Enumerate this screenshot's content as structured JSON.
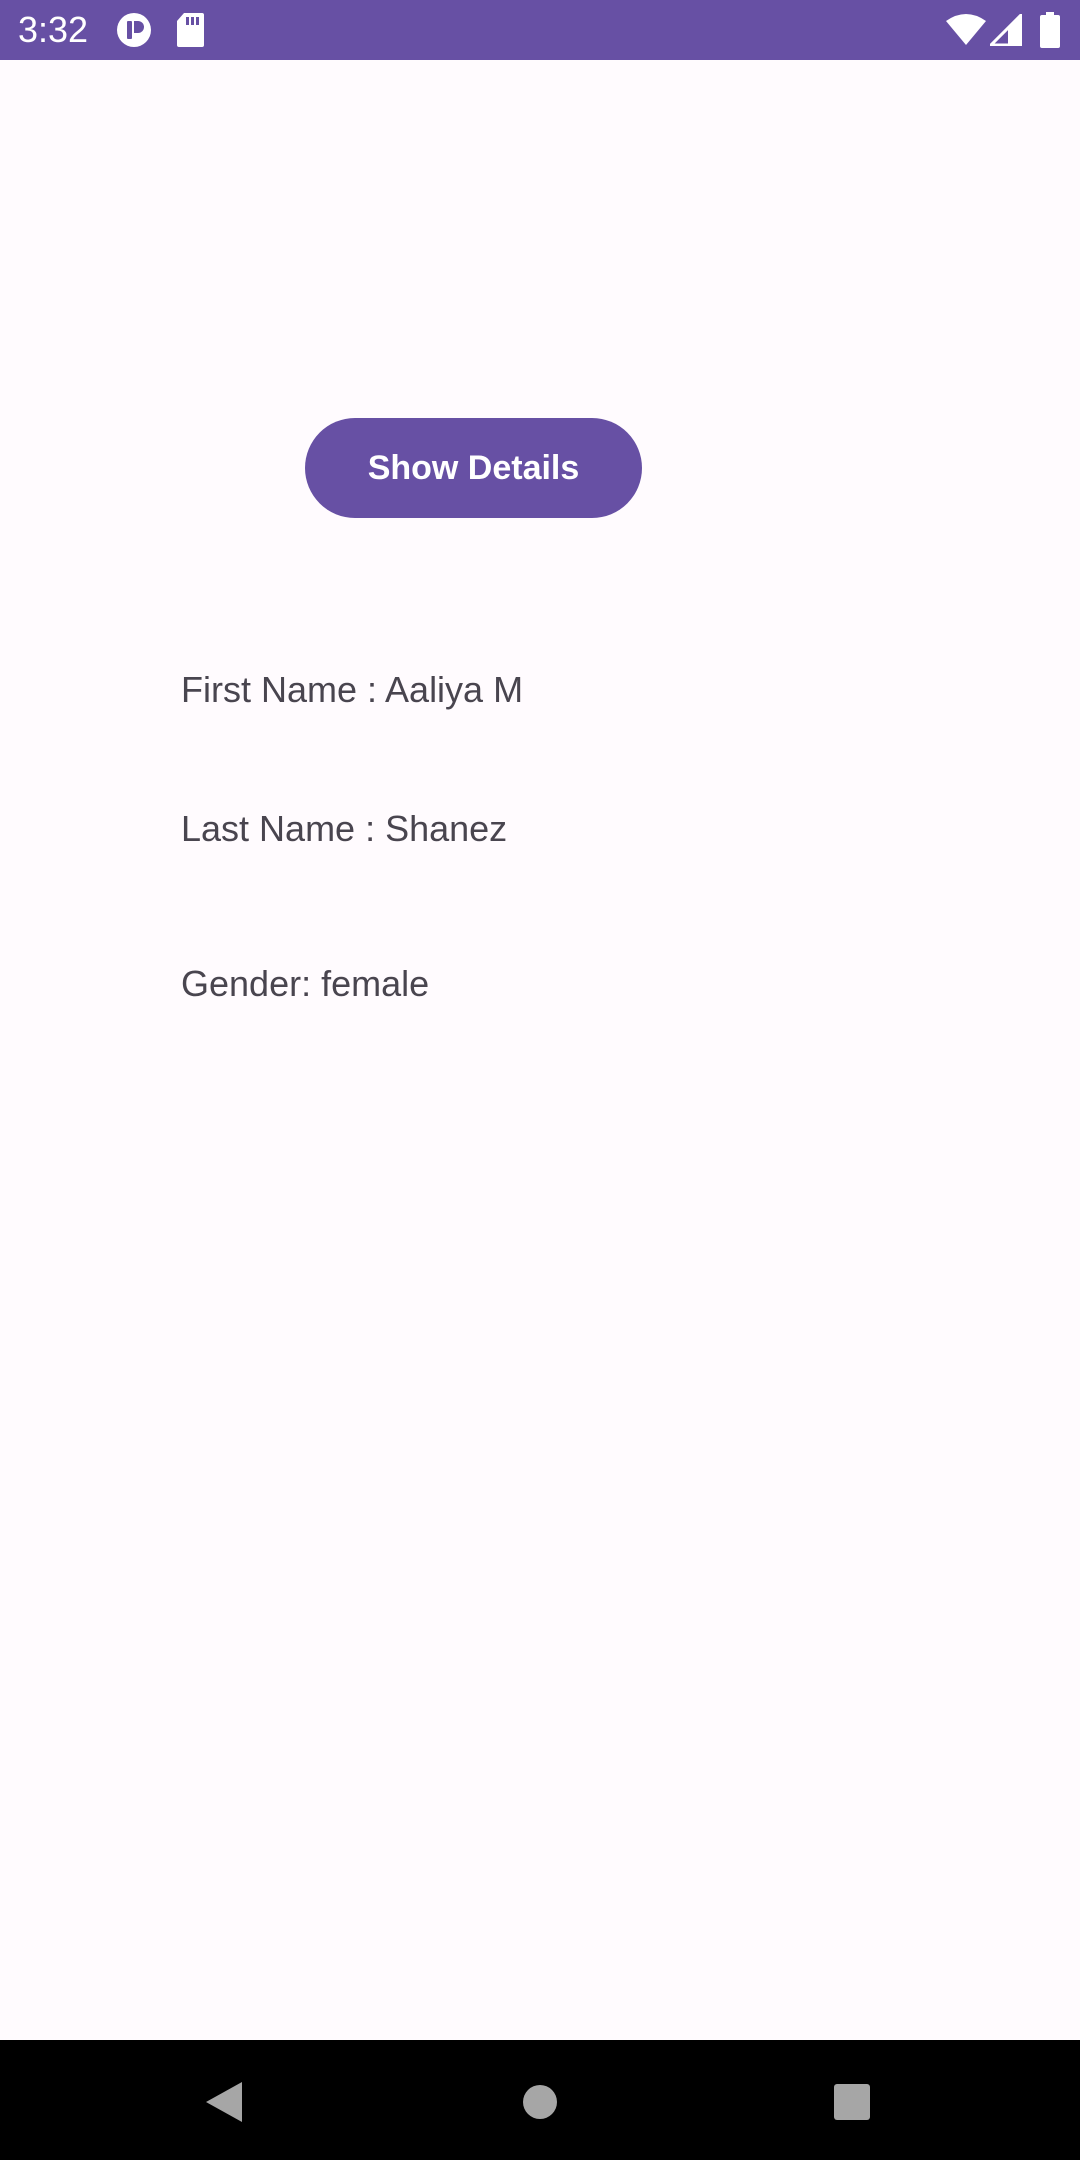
{
  "status_bar": {
    "time": "3:32",
    "color": "#6750a4",
    "icons": [
      "app-notification-icon",
      "sd-card-icon",
      "wifi-icon",
      "cell-signal-icon",
      "battery-icon"
    ]
  },
  "main": {
    "button_label": "Show Details",
    "first_name": "First Name : Aaliya M",
    "last_name": "Last Name : Shanez",
    "gender": "Gender: female"
  },
  "nav_bar": {
    "icons": [
      "back-icon",
      "home-icon",
      "recents-icon"
    ]
  },
  "colors": {
    "accent": "#6750a4",
    "background": "#fffbfe",
    "text": "#49454f"
  }
}
